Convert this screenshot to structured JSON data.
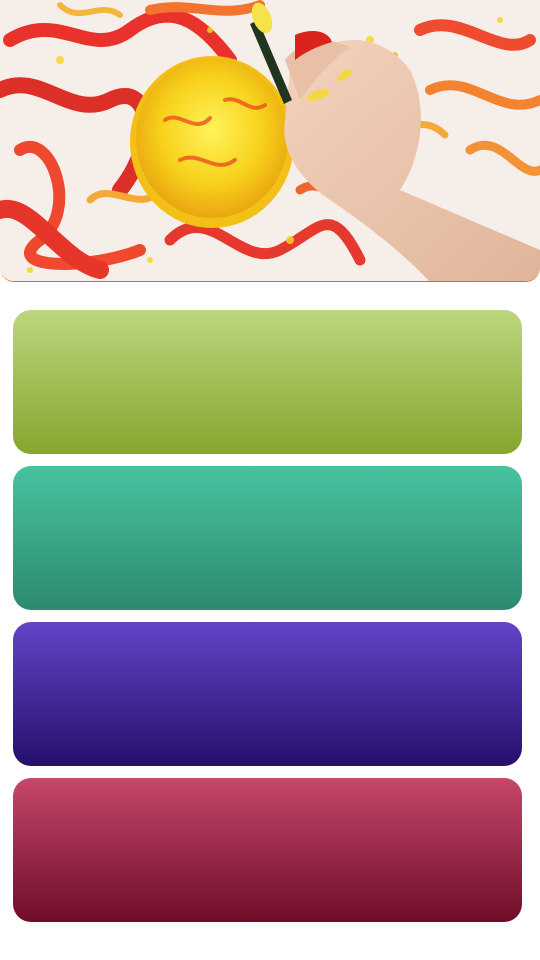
{
  "hero": {
    "photo_description_icon": "child-painting-photo",
    "accent_color": "#e8622a"
  },
  "tiles": [
    {
      "id": "tile-green",
      "color_top": "#bcd67e",
      "color_bottom": "#86a62d"
    },
    {
      "id": "tile-teal",
      "color_top": "#46c3a0",
      "color_bottom": "#2d8a6f"
    },
    {
      "id": "tile-purple",
      "color_top": "#6244c9",
      "color_bottom": "#260f6c"
    },
    {
      "id": "tile-crimson",
      "color_top": "#c6476a",
      "color_bottom": "#6e0d29"
    }
  ]
}
